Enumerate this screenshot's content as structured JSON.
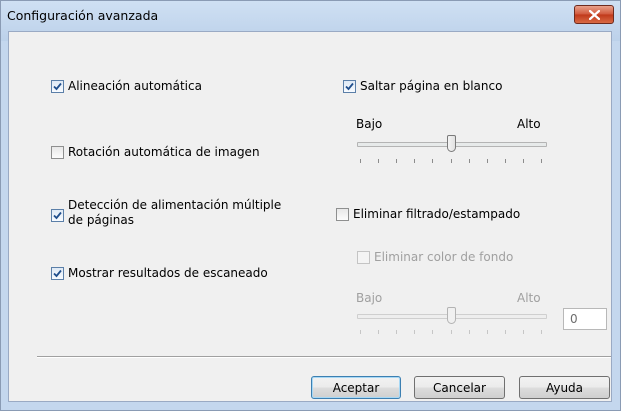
{
  "window": {
    "title": "Configuración avanzada"
  },
  "left_options": [
    {
      "label": "Alineación automática",
      "checked": true
    },
    {
      "label": "Rotación automática de imagen",
      "checked": false
    },
    {
      "label_line1": "Detección de alimentación múltiple",
      "label_line2": "de páginas",
      "checked": true
    },
    {
      "label": "Mostrar resultados de escaneado",
      "checked": true
    }
  ],
  "skip_blank": {
    "label": "Saltar página en blanco",
    "checked": true,
    "slider": {
      "min_label": "Bajo",
      "max_label": "Alto",
      "level_fraction": 0.5
    }
  },
  "remove_bleed": {
    "label": "Eliminar filtrado/estampado",
    "checked": false
  },
  "remove_background": {
    "label": "Eliminar color de fondo",
    "checked": false,
    "enabled": false,
    "slider": {
      "min_label": "Bajo",
      "max_label": "Alto",
      "level_fraction": 0.5
    },
    "value": "0"
  },
  "buttons": {
    "accept": "Aceptar",
    "cancel": "Cancelar",
    "help": "Ayuda"
  },
  "colors": {
    "check": "#1f4e8c",
    "title_bar": "#c4d7ee",
    "close_button": "#c8452a"
  }
}
